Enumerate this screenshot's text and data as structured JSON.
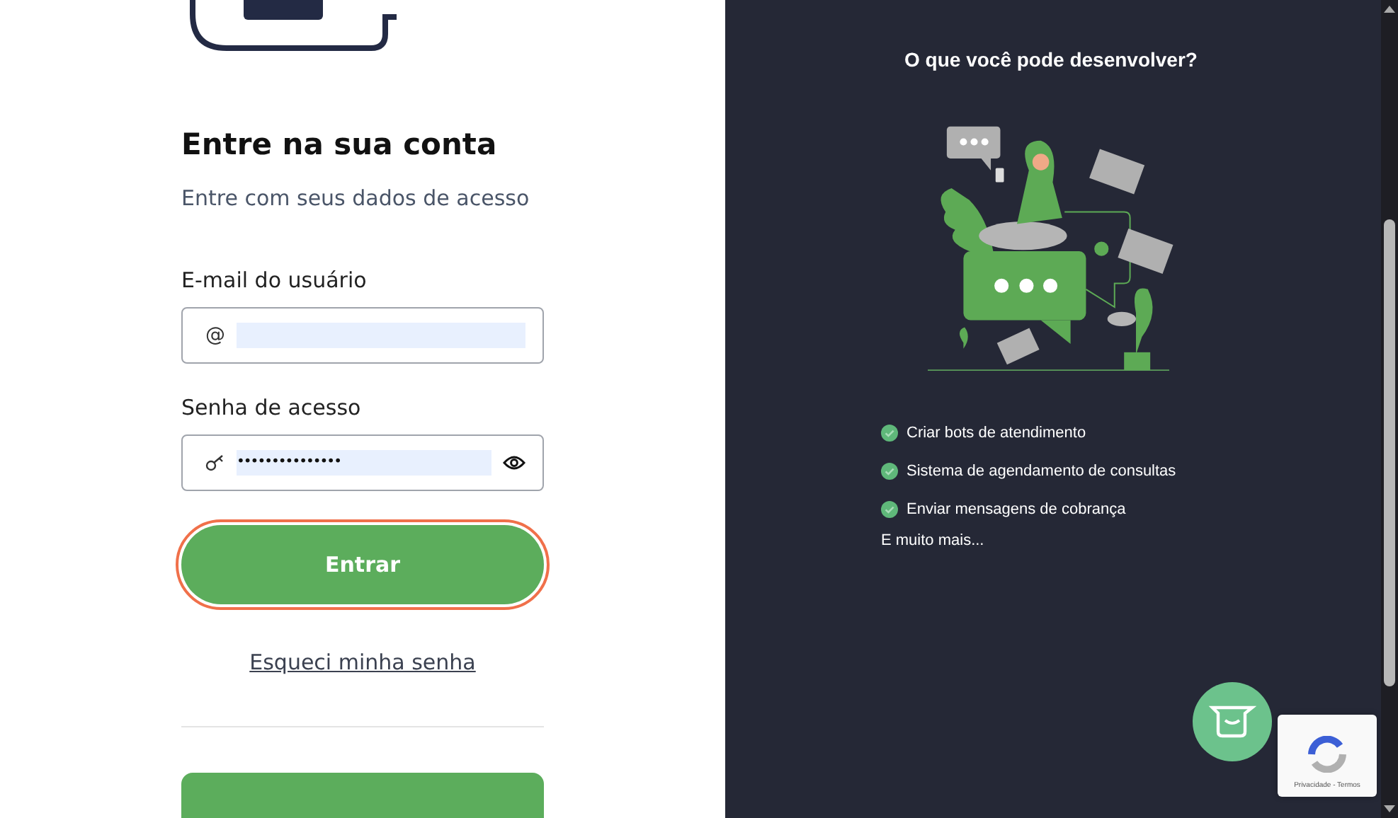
{
  "login": {
    "heading": "Entre na sua conta",
    "subheading": "Entre com seus dados de acesso",
    "email": {
      "label": "E-mail do usuário",
      "icon": "@"
    },
    "password": {
      "label": "Senha de acesso",
      "value": "•••••••••••••••"
    },
    "submit": {
      "label": "Entrar",
      "focused": true
    },
    "forgot_link": "Esqueci minha senha"
  },
  "promo": {
    "title": "O que você pode desenvolver?",
    "features": [
      "Criar bots de atendimento",
      "Sistema de agendamento de consultas",
      "Enviar mensagens de cobrança"
    ],
    "more": "E muito mais..."
  },
  "recaptcha": {
    "links": "Privacidade - Termos"
  }
}
